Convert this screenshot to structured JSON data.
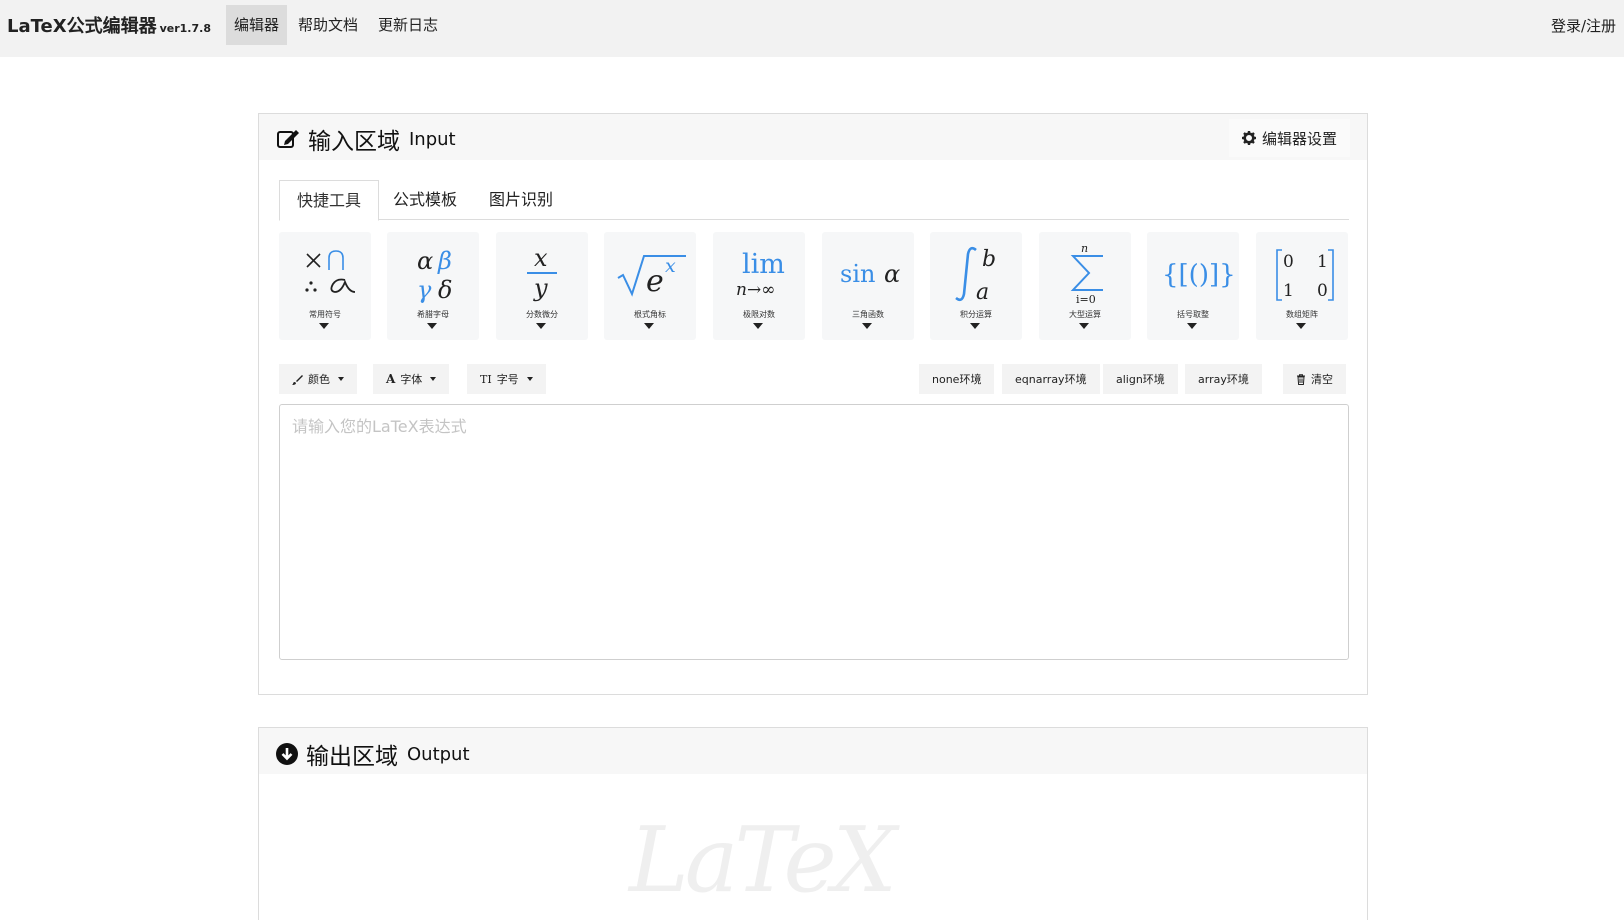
{
  "navbar": {
    "brand": "LaTeX公式编辑器",
    "version": "ver1.7.8",
    "items": [
      {
        "label": "编辑器",
        "active": true
      },
      {
        "label": "帮助文档",
        "active": false
      },
      {
        "label": "更新日志",
        "active": false
      }
    ],
    "login": "登录/注册"
  },
  "input_panel": {
    "title": "输入区域",
    "title_en": "Input",
    "title_icon": "edit-icon",
    "settings_label": "编辑器设置",
    "settings_icon": "gear-icon",
    "tabs": [
      {
        "label": "快捷工具",
        "active": true
      },
      {
        "label": "公式模板",
        "active": false
      },
      {
        "label": "图片识别",
        "active": false
      }
    ],
    "tools": [
      {
        "label": "常用符号"
      },
      {
        "label": "希腊字母"
      },
      {
        "label": "分数微分"
      },
      {
        "label": "根式角标"
      },
      {
        "label": "极限对数"
      },
      {
        "label": "三角函数"
      },
      {
        "label": "积分运算"
      },
      {
        "label": "大型运算"
      },
      {
        "label": "括号取整"
      },
      {
        "label": "数组矩阵"
      }
    ],
    "format": {
      "color": "颜色",
      "font": "字体",
      "size": "字号"
    },
    "envs": [
      "none环境",
      "eqnarray环境",
      "align环境",
      "array环境"
    ],
    "clear_label": "清空",
    "editor_placeholder": "请输入您的LaTeX表达式",
    "editor_value": ""
  },
  "output_panel": {
    "title": "输出区域",
    "title_en": "Output",
    "title_icon": "arrow-down-circle-icon",
    "watermark": "LaTeX"
  },
  "colors": {
    "accent": "#3a8ee6",
    "navbar_bg": "#f2f2f2",
    "tool_bg": "#f6f7f8"
  }
}
